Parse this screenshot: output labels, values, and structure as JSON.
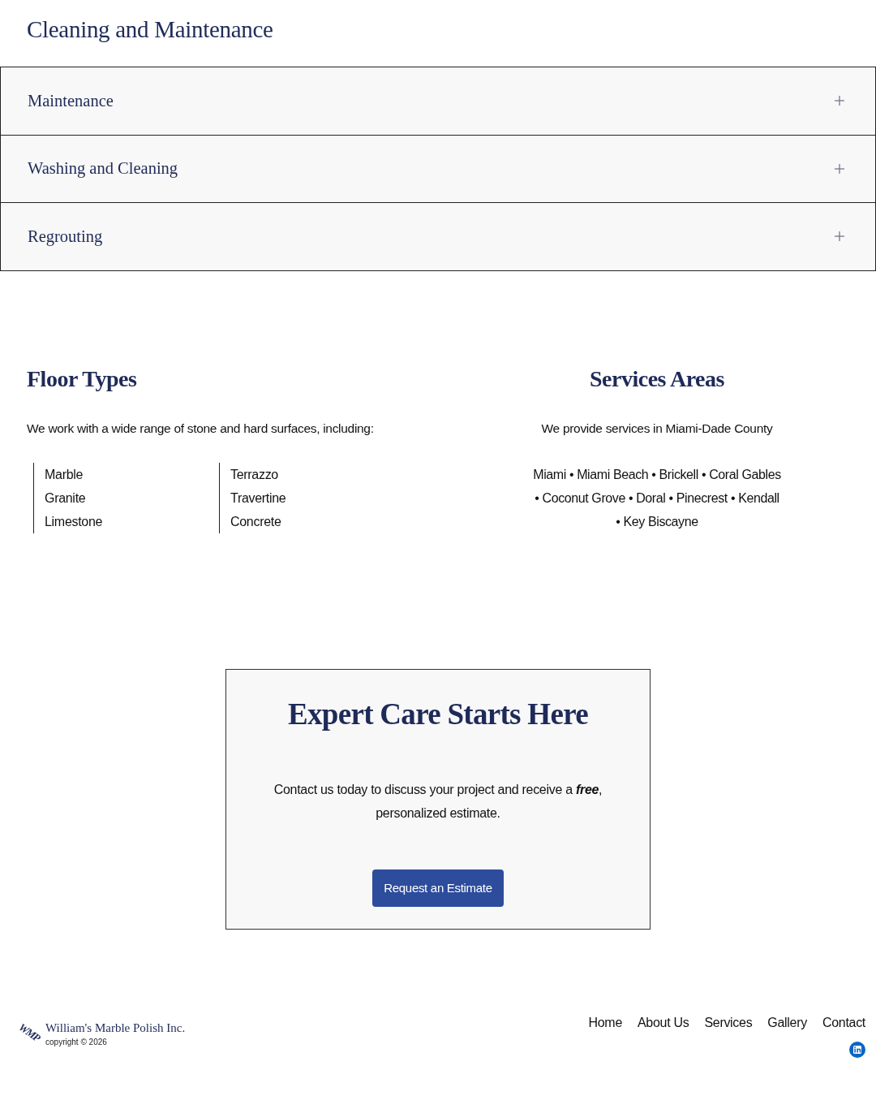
{
  "page_title": "Cleaning and Maintenance",
  "accordion": [
    {
      "label": "Maintenance",
      "expanded": false
    },
    {
      "label": "Washing and Cleaning",
      "expanded": false
    },
    {
      "label": "Regrouting",
      "expanded": false
    }
  ],
  "floor_types": {
    "heading": "Floor Types",
    "intro": "We work with a wide range of stone and hard surfaces, including:",
    "columns": [
      [
        "Marble",
        "Granite",
        "Limestone"
      ],
      [
        "Terrazzo",
        "Travertine",
        "Concrete"
      ]
    ]
  },
  "service_areas": {
    "heading": "Services Areas",
    "intro": "We provide services in Miami-Dade County",
    "areas": "Miami • Miami Beach • Brickell • Coral Gables • Coconut Grove • Doral • Pinecrest • Kendall • Key Biscayne"
  },
  "cta": {
    "heading": "Expert Care Starts Here",
    "text": "Contact us today to discuss your project and receive a *free*, personalized estimate.",
    "button": "Request an Estimate"
  },
  "footer": {
    "logo": "WMP",
    "company": "William's Marble Polish Inc.",
    "copyright": "copyright © 2026",
    "nav": [
      "Home",
      "About Us",
      "Services",
      "Gallery",
      "Contact"
    ],
    "social": [
      {
        "kind": "linkedin"
      }
    ]
  }
}
